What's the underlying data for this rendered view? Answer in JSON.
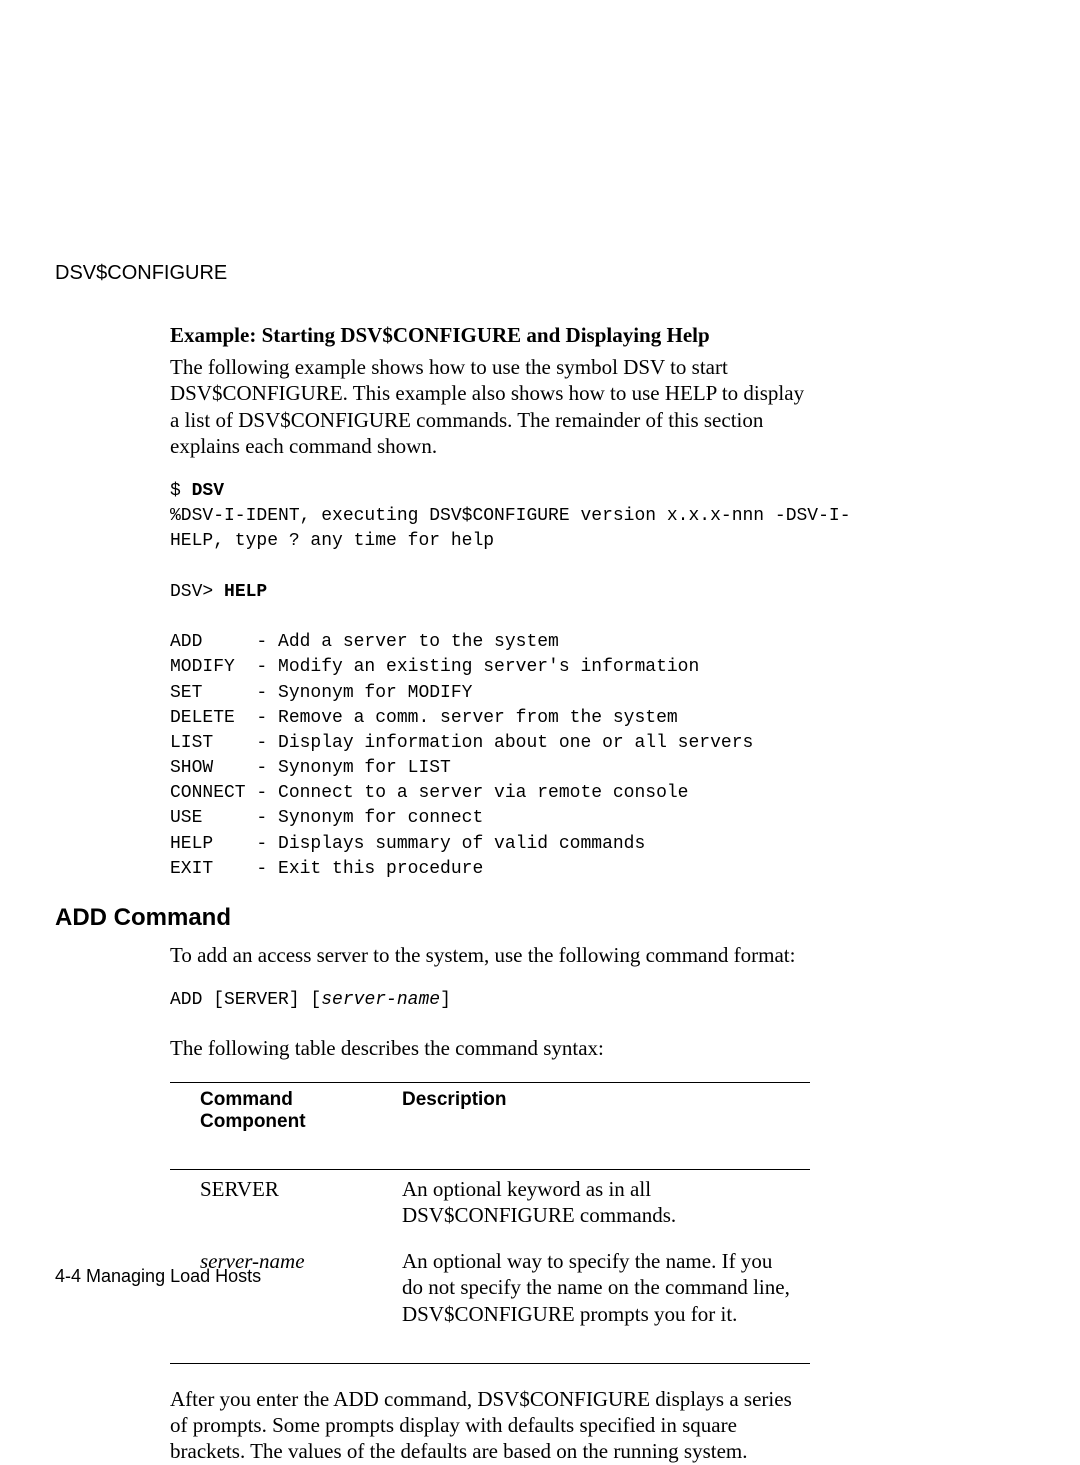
{
  "header": {
    "running": "DSV$CONFIGURE"
  },
  "example": {
    "title": "Example: Starting DSV$CONFIGURE and Displaying Help",
    "intro": "The following example shows how to use the symbol DSV to start DSV$CONFIGURE. This example also shows how to use HELP to display a list of DSV$CONFIGURE commands. The remainder of this section explains each command shown.",
    "block1_prompt": "$ ",
    "block1_cmd": "DSV",
    "block1_out": "%DSV-I-IDENT, executing DSV$CONFIGURE version x.x.x-nnn -DSV-I-\nHELP, type ? any time for help",
    "block2_prompt": "DSV> ",
    "block2_cmd": "HELP",
    "help_lines": "ADD     - Add a server to the system\nMODIFY  - Modify an existing server's information\nSET     - Synonym for MODIFY\nDELETE  - Remove a comm. server from the system\nLIST    - Display information about one or all servers\nSHOW    - Synonym for LIST\nCONNECT - Connect to a server via remote console\nUSE     - Synonym for connect\nHELP    - Displays summary of valid commands\nEXIT    - Exit this procedure"
  },
  "add": {
    "heading": "ADD Command",
    "intro": "To add an access server to the system, use the following command format:",
    "syntax_pre": "ADD [SERVER] [",
    "syntax_var": "server-name",
    "syntax_post": "]",
    "table_intro": "The following table describes the command syntax:",
    "col1_head": "Command Component",
    "col2_head": "Description",
    "row1_c1": "SERVER",
    "row1_c2": "An optional keyword as in all DSV$CONFIGURE commands.",
    "row2_c1": "server-name",
    "row2_c2": "An optional way to specify the name. If you do not specify the name on the command line, DSV$CONFIGURE prompts you for it.",
    "outro": "After you enter the ADD command, DSV$CONFIGURE displays a series of prompts. Some prompts display with defaults specified in square brackets. The values of the defaults are based on the running system."
  },
  "footer": {
    "text": "4-4  Managing Load Hosts"
  }
}
